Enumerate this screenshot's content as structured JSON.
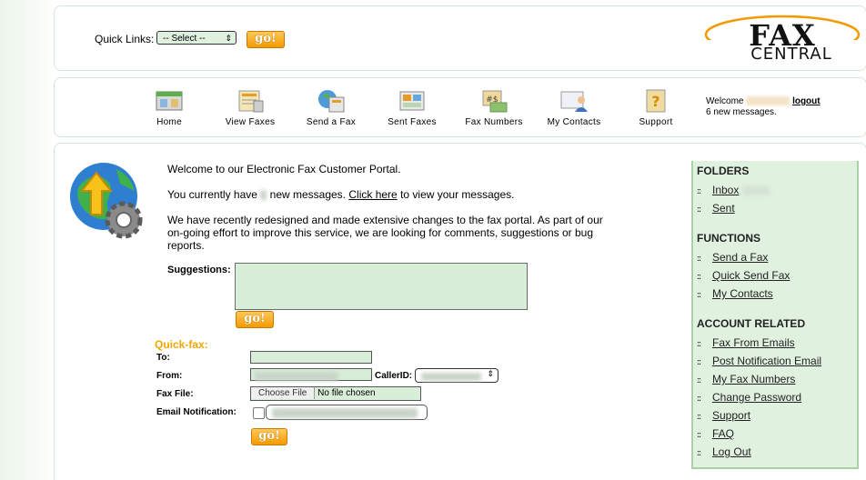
{
  "header": {
    "quick_links_label": "Quick Links:",
    "quick_links_value": "-- Select --",
    "go_label": "go!",
    "logo_line1": "FAX",
    "logo_line2": "CENTRAL"
  },
  "nav": {
    "items": [
      {
        "label": "Home",
        "icon": "home-icon"
      },
      {
        "label": "View Faxes",
        "icon": "view-faxes-icon"
      },
      {
        "label": "Send a Fax",
        "icon": "send-fax-icon"
      },
      {
        "label": "Sent Faxes",
        "icon": "sent-faxes-icon"
      },
      {
        "label": "Fax Numbers",
        "icon": "fax-numbers-icon"
      },
      {
        "label": "My Contacts",
        "icon": "contacts-icon"
      },
      {
        "label": "Support",
        "icon": "support-icon"
      }
    ],
    "welcome_label": "Welcome",
    "logout_label": "logout",
    "new_messages_text": "6 new messages."
  },
  "main": {
    "welcome_text": "Welcome to our Electronic Fax Customer Portal.",
    "messages_prefix": "You currently have",
    "messages_middle": "new messages.",
    "click_here_label": "Click here",
    "messages_suffix": "to view your messages.",
    "redesign_text": "We have recently redesigned and made extensive changes to the fax portal. As part of our on-going effort to improve this service, we are looking for comments, suggestions or bug reports.",
    "suggestions_label": "Suggestions:",
    "go_label": "go!"
  },
  "quickfax": {
    "title": "Quick-fax:",
    "to_label": "To:",
    "from_label": "From:",
    "callerid_label": "CallerID:",
    "fax_file_label": "Fax File:",
    "choose_file_label": "Choose File",
    "no_file_text": "No file chosen",
    "email_notification_label": "Email Notification:",
    "go_label": "go!"
  },
  "sidebar": {
    "folders_heading": "FOLDERS",
    "folders": [
      "Inbox",
      "Sent"
    ],
    "functions_heading": "FUNCTIONS",
    "functions": [
      "Send a Fax",
      "Quick Send Fax",
      "My Contacts"
    ],
    "account_heading": "ACCOUNT RELATED",
    "account": [
      "Fax From Emails",
      "Post Notification Email",
      "My Fax Numbers",
      "Change Password",
      "Support",
      "FAQ",
      "Log Out"
    ]
  },
  "colors": {
    "accent_orange": "#f39a00",
    "field_green": "#d8eed8",
    "sidebar_green": "#e0f1e0",
    "quickfax_title": "#f2a600"
  }
}
